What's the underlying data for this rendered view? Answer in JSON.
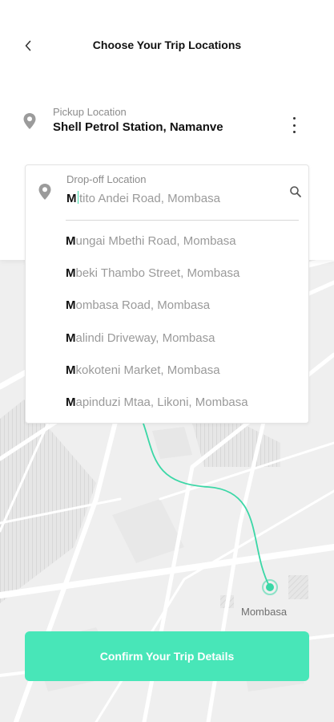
{
  "header": {
    "title": "Choose Your Trip Locations"
  },
  "pickup": {
    "label": "Pickup Location",
    "value": "Shell Petrol Station, Namanve"
  },
  "dropoff": {
    "label": "Drop-off Location",
    "typed": "M",
    "completion": "tito Andei Road, Mombasa"
  },
  "suggestions": [
    {
      "first": "M",
      "rest": "ungai Mbethi Road, Mombasa"
    },
    {
      "first": "M",
      "rest": "beki Thambo Street, Mombasa"
    },
    {
      "first": "M",
      "rest": "ombasa Road, Mombasa"
    },
    {
      "first": "M",
      "rest": "alindi Driveway, Mombasa"
    },
    {
      "first": "M",
      "rest": "kokoteni Market, Mombasa"
    },
    {
      "first": "M",
      "rest": "apinduzi Mtaa, Likoni, Mombasa"
    }
  ],
  "map": {
    "destination_label": "Mombasa"
  },
  "confirm_button": {
    "label": "Confirm Your Trip Details"
  },
  "colors": {
    "accent": "#48e6b8",
    "route": "#3ad7a6",
    "map_bg": "#efefef"
  },
  "icons": {
    "back": "chevron-left-icon",
    "pin": "location-pin-icon",
    "more": "more-vertical-icon",
    "search": "search-icon"
  }
}
